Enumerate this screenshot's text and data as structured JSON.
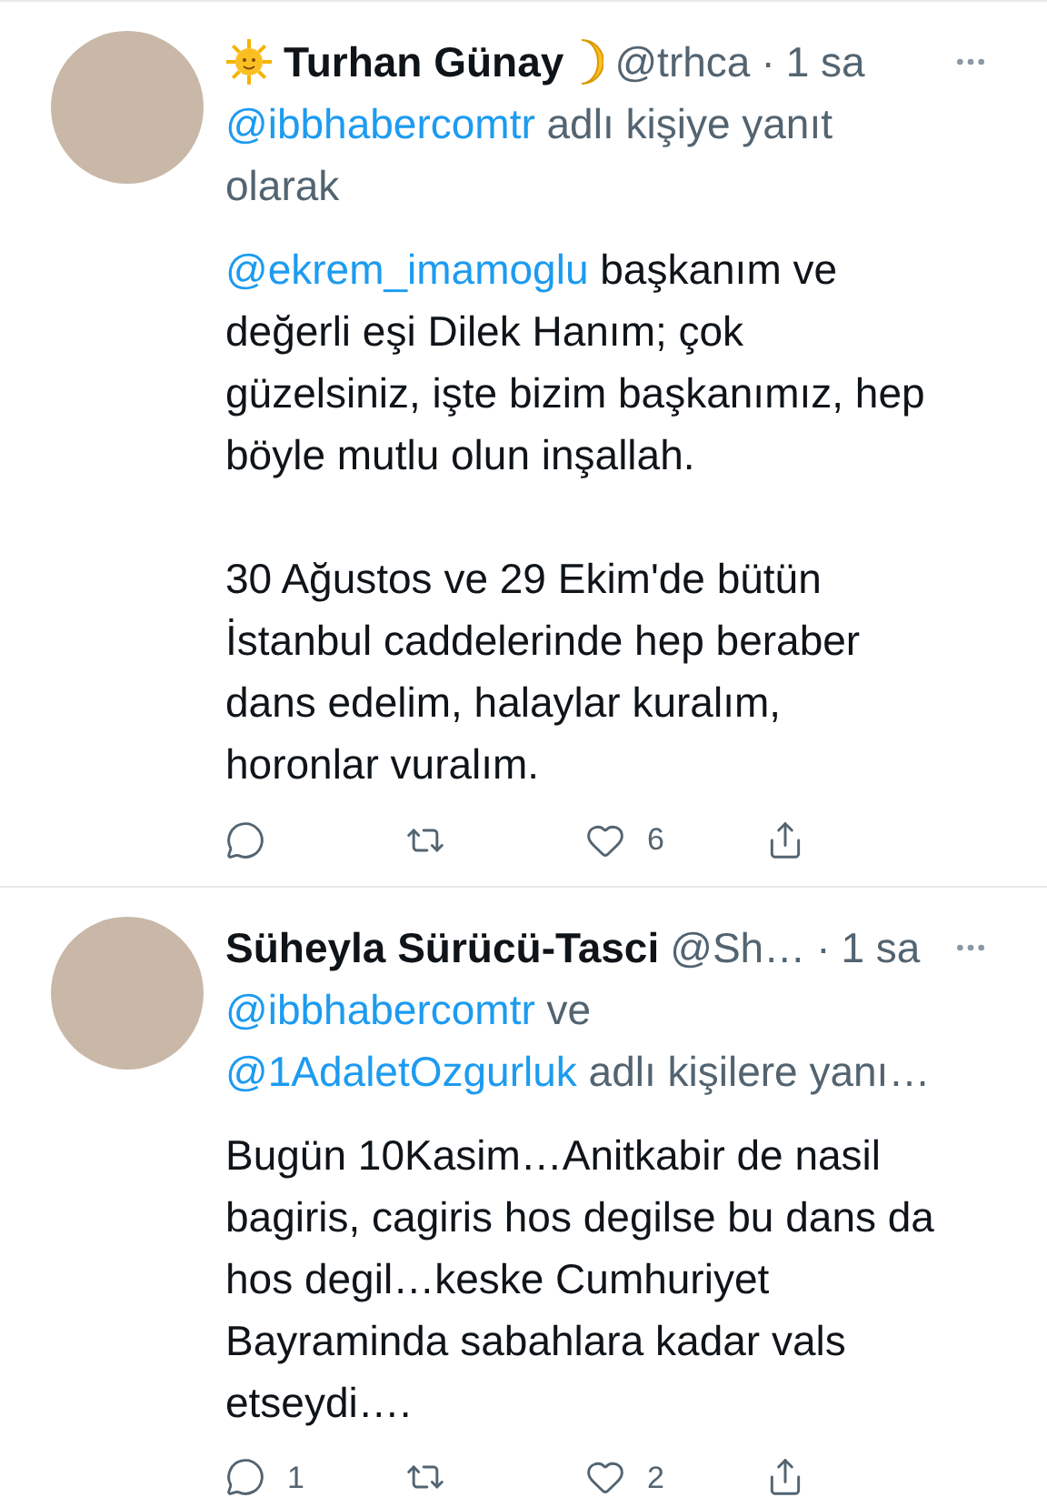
{
  "tweets": [
    {
      "name": "Turhan Günay",
      "emoji_before": {
        "kind": "sun"
      },
      "emoji_after": {
        "kind": "moon"
      },
      "handle": "@trhca",
      "separator": "·",
      "time": "1 sa",
      "reply_to": [
        {
          "kind": "mention",
          "text": "@ibbhabercomtr"
        },
        {
          "kind": "plain",
          "text": "adlı kişiye yanıt olarak"
        }
      ],
      "paragraphs": [
        [
          {
            "kind": "mention",
            "text": "@ekrem_imamoglu"
          },
          {
            "kind": "plain",
            "text": "başkanım ve değerli eşi Dilek Hanım; çok güzelsiniz, işte bizim başkanımız, hep böyle mutlu olun inşallah."
          }
        ],
        [
          {
            "kind": "plain",
            "text": "30 Ağustos ve 29 Ekim'de bütün İstanbul caddelerinde hep beraber dans edelim, halaylar kuralım, horonlar vuralım."
          }
        ]
      ],
      "actions": [
        {
          "kind": "reply"
        },
        {
          "kind": "retweet"
        },
        {
          "kind": "like",
          "count": "6"
        },
        {
          "kind": "share"
        }
      ]
    },
    {
      "name": "Süheyla Sürücü-Tasci",
      "handle": "@Sh…",
      "separator": "·",
      "time": "1 sa",
      "reply_to": [
        {
          "kind": "mention",
          "text": "@ibbhabercomtr"
        },
        {
          "kind": "plain",
          "text": "ve"
        },
        {
          "kind": "mention",
          "text": "@1AdaletOzgurluk"
        },
        {
          "kind": "plain",
          "text": "adlı kişilere yanı…"
        }
      ],
      "paragraphs": [
        [
          {
            "kind": "plain",
            "text": "Bugün 10Kasim…Anitkabir de nasil bagiris, cagiris hos degilse bu dans da hos degil…keske Cumhuriyet Bayraminda sabahlara kadar vals etseydi…."
          }
        ]
      ],
      "actions": [
        {
          "kind": "reply",
          "count": "1"
        },
        {
          "kind": "retweet"
        },
        {
          "kind": "like",
          "count": "2"
        },
        {
          "kind": "share"
        }
      ]
    }
  ]
}
